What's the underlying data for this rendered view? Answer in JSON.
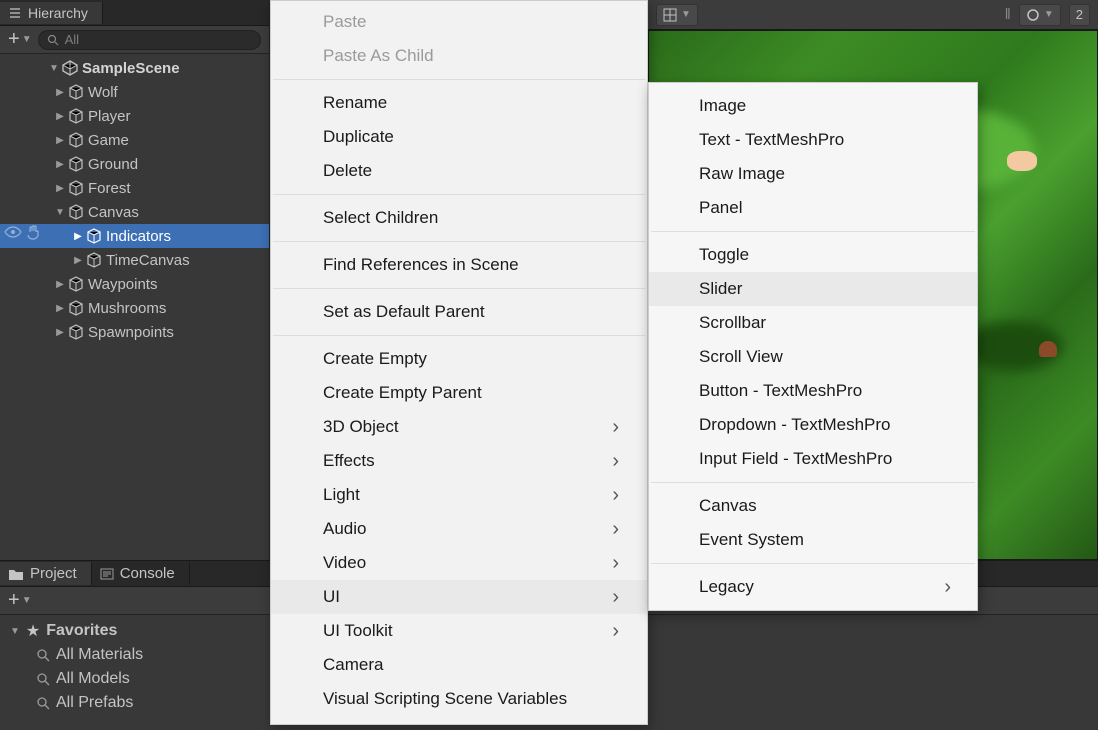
{
  "hierarchy": {
    "tab_label": "Hierarchy",
    "search_placeholder": "All",
    "scene": "SampleScene",
    "items": [
      {
        "label": "Wolf",
        "depth": 1,
        "expandable": true
      },
      {
        "label": "Player",
        "depth": 1,
        "expandable": true
      },
      {
        "label": "Game",
        "depth": 1,
        "expandable": true
      },
      {
        "label": "Ground",
        "depth": 1,
        "expandable": true
      },
      {
        "label": "Forest",
        "depth": 1,
        "expandable": true
      },
      {
        "label": "Canvas",
        "depth": 1,
        "expandable": true,
        "expanded": true
      },
      {
        "label": "Indicators",
        "depth": 2,
        "expandable": true,
        "selected": true
      },
      {
        "label": "TimeCanvas",
        "depth": 2,
        "expandable": true
      },
      {
        "label": "Waypoints",
        "depth": 1,
        "expandable": true
      },
      {
        "label": "Mushrooms",
        "depth": 1,
        "expandable": true
      },
      {
        "label": "Spawnpoints",
        "depth": 1,
        "expandable": true
      }
    ]
  },
  "project": {
    "tab1": "Project",
    "tab2": "Console",
    "favorites_label": "Favorites",
    "favorites": [
      {
        "label": "All Materials"
      },
      {
        "label": "All Models"
      },
      {
        "label": "All Prefabs"
      }
    ]
  },
  "scene_toolbar": {
    "gizmo": "2"
  },
  "context_menu": {
    "items": [
      {
        "label": "Paste",
        "disabled": true
      },
      {
        "label": "Paste As Child",
        "disabled": true
      },
      {
        "sep": true
      },
      {
        "label": "Rename"
      },
      {
        "label": "Duplicate"
      },
      {
        "label": "Delete"
      },
      {
        "sep": true
      },
      {
        "label": "Select Children"
      },
      {
        "sep": true
      },
      {
        "label": "Find References in Scene"
      },
      {
        "sep": true
      },
      {
        "label": "Set as Default Parent"
      },
      {
        "sep": true
      },
      {
        "label": "Create Empty"
      },
      {
        "label": "Create Empty Parent"
      },
      {
        "label": "3D Object",
        "submenu": true
      },
      {
        "label": "Effects",
        "submenu": true
      },
      {
        "label": "Light",
        "submenu": true
      },
      {
        "label": "Audio",
        "submenu": true
      },
      {
        "label": "Video",
        "submenu": true
      },
      {
        "label": "UI",
        "submenu": true,
        "highlighted": true
      },
      {
        "label": "UI Toolkit",
        "submenu": true
      },
      {
        "label": "Camera"
      },
      {
        "label": "Visual Scripting Scene Variables"
      }
    ]
  },
  "submenu_ui": {
    "items": [
      {
        "label": "Image"
      },
      {
        "label": "Text - TextMeshPro"
      },
      {
        "label": "Raw Image"
      },
      {
        "label": "Panel"
      },
      {
        "sep": true
      },
      {
        "label": "Toggle"
      },
      {
        "label": "Slider",
        "highlighted": true
      },
      {
        "label": "Scrollbar"
      },
      {
        "label": "Scroll View"
      },
      {
        "label": "Button - TextMeshPro"
      },
      {
        "label": "Dropdown - TextMeshPro"
      },
      {
        "label": "Input Field - TextMeshPro"
      },
      {
        "sep": true
      },
      {
        "label": "Canvas"
      },
      {
        "label": "Event System"
      },
      {
        "sep": true
      },
      {
        "label": "Legacy",
        "submenu": true
      }
    ]
  }
}
